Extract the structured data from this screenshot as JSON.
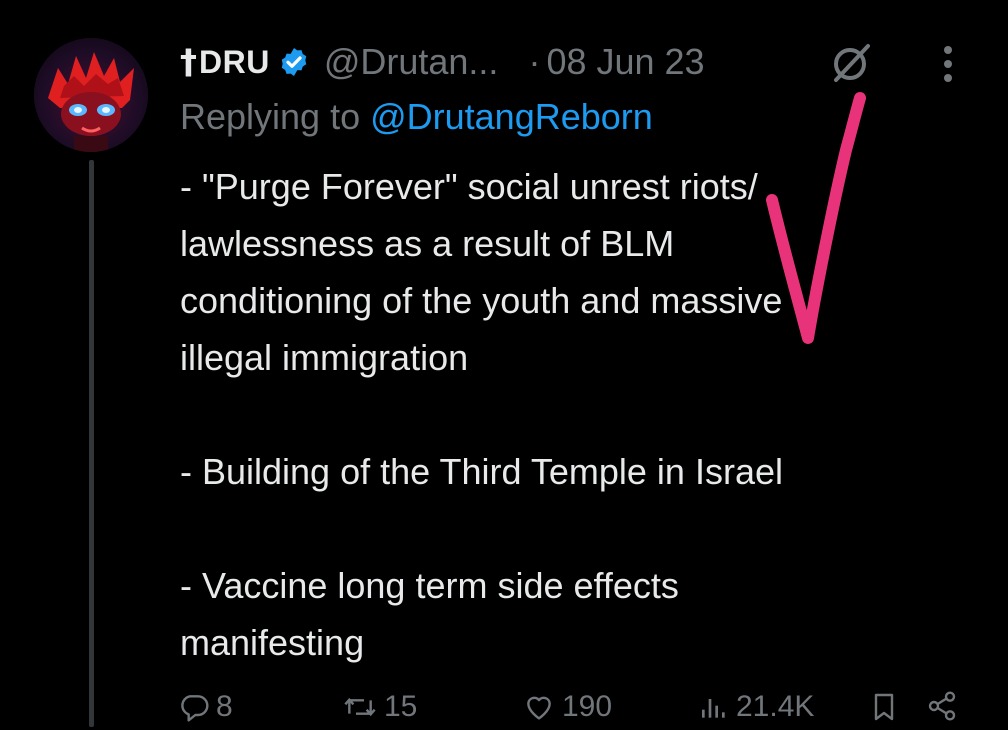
{
  "tweet": {
    "author": {
      "name_glyph": "†",
      "name": "DRU",
      "handle": "@Drutan...",
      "verified": true,
      "avatar": "red-haired-anime-character-avatar"
    },
    "separator": "·",
    "date": "08 Jun 23",
    "header_icons": [
      "grok-icon",
      "more-icon"
    ],
    "reply_prefix": "Replying to ",
    "reply_to": "@DrutangReborn",
    "paragraphs": [
      "- \"Purge Forever\" social unrest riots/\nlawlessness as a result of BLM\nconditioning of the youth and massive\nillegal immigration",
      "- Building of the Third Temple in Israel",
      "- Vaccine long term side effects\nmanifesting"
    ],
    "actions": {
      "replies": "8",
      "reposts": "15",
      "likes": "190",
      "views": "21.4K"
    },
    "action_icons": [
      "reply-icon",
      "repost-icon",
      "like-icon",
      "views-icon",
      "bookmark-icon",
      "share-icon"
    ]
  },
  "colors": {
    "background": "#000000",
    "text_primary": "#e7e9ea",
    "text_secondary": "#71767b",
    "accent": "#1d9bf0",
    "annotation": "#e8337a"
  },
  "annotation": {
    "type": "handwritten-checkmark",
    "color": "#e8337a"
  }
}
